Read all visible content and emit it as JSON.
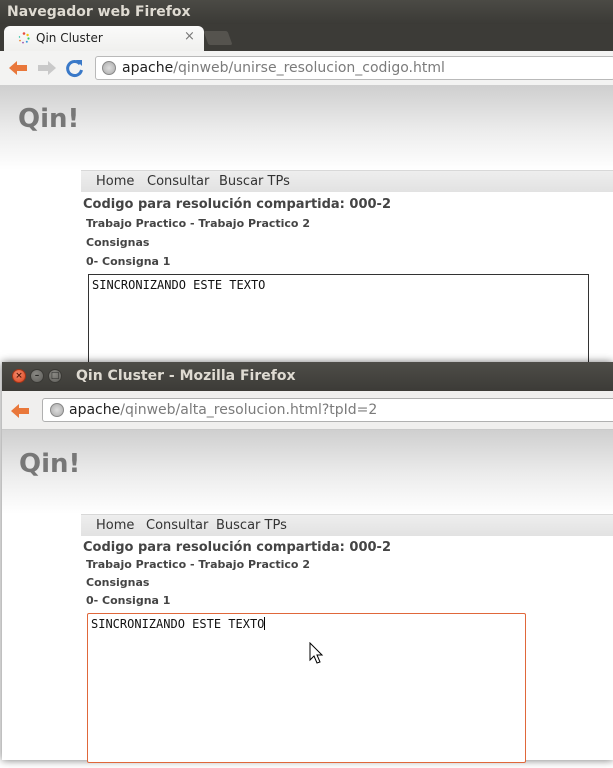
{
  "window1": {
    "title": "Navegador web Firefox",
    "tab_label": "Qin Cluster",
    "tab_close": "×",
    "url_host": "apache",
    "url_path": "/qinweb/unirse_resolucion_codigo.html",
    "page": {
      "brand": "Qin!",
      "menu": [
        "Home",
        "Consultar",
        "Buscar TPs"
      ],
      "heading": "Codigo para resolución compartida: 000-2",
      "trabajo": "Trabajo Practico - Trabajo Practico 2",
      "consignas": "Consignas",
      "consigna": "0- Consigna 1",
      "textarea_value": "SINCRONIZANDO ESTE TEXTO"
    }
  },
  "window2": {
    "title": "Qin Cluster - Mozilla Firefox",
    "url_host": "apache",
    "url_path": "/qinweb/alta_resolucion.html?tpId=2",
    "page": {
      "brand": "Qin!",
      "menu": [
        "Home",
        "Consultar",
        "Buscar TPs"
      ],
      "heading": "Codigo para resolución compartida: 000-2",
      "trabajo": "Trabajo Practico - Trabajo Practico 2",
      "consignas": "Consignas",
      "consigna": "0- Consigna 1",
      "textarea_value": "SINCRONIZANDO ESTE TEXTO"
    }
  },
  "colors": {
    "back_arrow": "#e9773a",
    "reload": "#3a79c8",
    "focus_border": "#e0673a",
    "close_button": "#e8553a"
  },
  "icons": [
    "loading-favicon-icon",
    "back-arrow-icon",
    "forward-arrow-icon",
    "reload-icon",
    "globe-icon",
    "close-window-icon",
    "minimize-window-icon",
    "maximize-window-icon",
    "mouse-cursor-icon"
  ]
}
